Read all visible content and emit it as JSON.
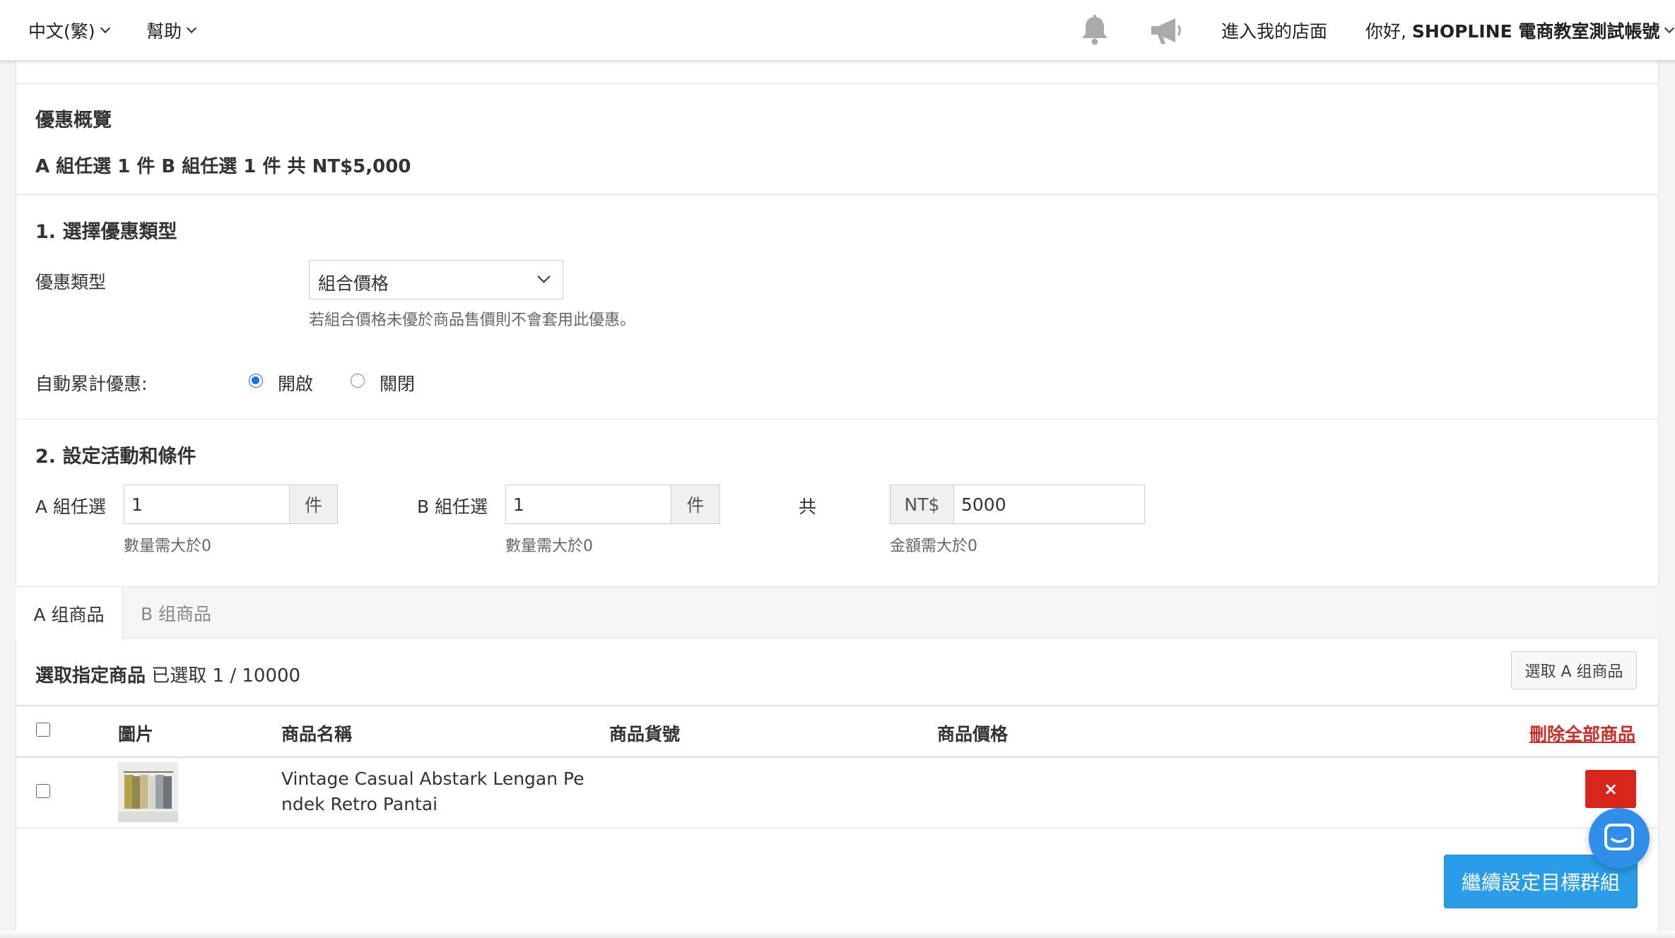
{
  "topbar": {
    "language": "中文(繁)",
    "help": "幫助",
    "visit_store": "進入我的店面",
    "greeting_prefix": "你好,",
    "account_name": "SHOPLINE 電商教室測試帳號"
  },
  "overview": {
    "title": "優惠概覽",
    "summary": "A 組任選 1 件 B 組任選 1 件 共 NT$5,000"
  },
  "step1": {
    "title": "1. 選擇優惠類型",
    "type_label": "優惠類型",
    "type_value": "組合價格",
    "type_help": "若組合價格未優於商品售價則不會套用此優惠。",
    "auto_stack_label": "自動累計優惠:",
    "option_on": "開啟",
    "option_off": "關閉",
    "auto_stack_selected": "開啟"
  },
  "step2": {
    "title": "2. 設定活動和條件",
    "a_label": "A 組任選",
    "a_value": "1",
    "a_unit": "件",
    "a_help": "數量需大於0",
    "b_label": "B 組任選",
    "b_value": "1",
    "b_unit": "件",
    "b_help": "數量需大於0",
    "total_label": "共",
    "currency": "NT$",
    "amount_value": "5000",
    "amount_help": "金額需大於0"
  },
  "tabs": [
    {
      "label": "A 组商品",
      "active": true
    },
    {
      "label": "B 组商品",
      "active": false
    }
  ],
  "products": {
    "title": "選取指定商品",
    "selected_count": "已選取 1 / 10000",
    "select_button": "選取 A 组商品",
    "columns": {
      "image": "圖片",
      "name": "商品名稱",
      "sku": "商品貨號",
      "price": "商品價格"
    },
    "delete_all": "刪除全部商品",
    "rows": [
      {
        "name_line1": "Vintage Casual Abstark Lengan Pe",
        "name_line2": "ndek Retro Pantai",
        "sku": "",
        "price": "",
        "delete_icon": "×"
      }
    ]
  },
  "footer": {
    "continue_button": "繼續設定目標群組"
  },
  "icons": {
    "notifications": "bell-icon",
    "announcements": "megaphone-icon",
    "chat": "chat-icon"
  },
  "colors": {
    "primary": "#2a9ce8",
    "danger": "#d9251c",
    "radio_checked": "#1a73e8",
    "link_danger": "#c9302c"
  }
}
